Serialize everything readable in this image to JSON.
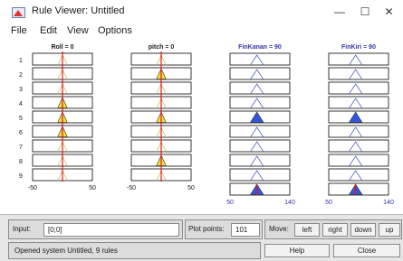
{
  "window": {
    "title": "Rule Viewer: Untitled",
    "controls": {
      "minimize": "—",
      "maximize": "☐",
      "close": "✕"
    }
  },
  "menu": {
    "file": "File",
    "edit": "Edit",
    "view": "View",
    "options": "Options"
  },
  "variables": {
    "inputs": [
      {
        "label": "Roll = 0",
        "range": [
          -50,
          50
        ],
        "range_labels": [
          "-50",
          "50"
        ],
        "value": 0
      },
      {
        "label": "pitch = 0",
        "range": [
          -50,
          50
        ],
        "range_labels": [
          "-50",
          "50"
        ],
        "value": 0
      }
    ],
    "outputs": [
      {
        "label": "FinKanan = 90",
        "range": [
          50,
          140
        ],
        "range_labels": [
          "50",
          "140"
        ],
        "value": 90
      },
      {
        "label": "FinKiri = 90",
        "range": [
          50,
          140
        ],
        "range_labels": [
          "50",
          "140"
        ],
        "value": 90
      }
    ]
  },
  "rule_numbers": [
    "1",
    "2",
    "3",
    "4",
    "5",
    "6",
    "7",
    "8",
    "9"
  ],
  "rules": [
    {
      "roll_active": false,
      "pitch_active": false,
      "finkanan_active": false,
      "finkiri_active": false
    },
    {
      "roll_active": false,
      "pitch_active": true,
      "finkanan_active": false,
      "finkiri_active": false
    },
    {
      "roll_active": false,
      "pitch_active": false,
      "finkanan_active": false,
      "finkiri_active": false
    },
    {
      "roll_active": true,
      "pitch_active": false,
      "finkanan_active": false,
      "finkiri_active": false
    },
    {
      "roll_active": true,
      "pitch_active": true,
      "finkanan_active": true,
      "finkiri_active": true
    },
    {
      "roll_active": true,
      "pitch_active": false,
      "finkanan_active": false,
      "finkiri_active": false
    },
    {
      "roll_active": false,
      "pitch_active": false,
      "finkanan_active": false,
      "finkiri_active": false
    },
    {
      "roll_active": false,
      "pitch_active": true,
      "finkanan_active": false,
      "finkiri_active": false
    },
    {
      "roll_active": false,
      "pitch_active": false,
      "finkanan_active": false,
      "finkiri_active": false
    }
  ],
  "colors": {
    "input_fill": "#f0e040",
    "output_fill": "#3355dd",
    "index_line": "#ee1111",
    "box_border": "#222222",
    "output_label": "#3333aa"
  },
  "controls": {
    "input_label": "Input:",
    "input_value": "[0;0]",
    "plot_points_label": "Plot points:",
    "plot_points_value": "101",
    "move_label": "Move:",
    "move_left": "left",
    "move_right": "right",
    "move_down": "down",
    "move_up": "up",
    "help_label": "Help",
    "close_label": "Close",
    "status_text": "Opened system Untitled, 9 rules"
  }
}
